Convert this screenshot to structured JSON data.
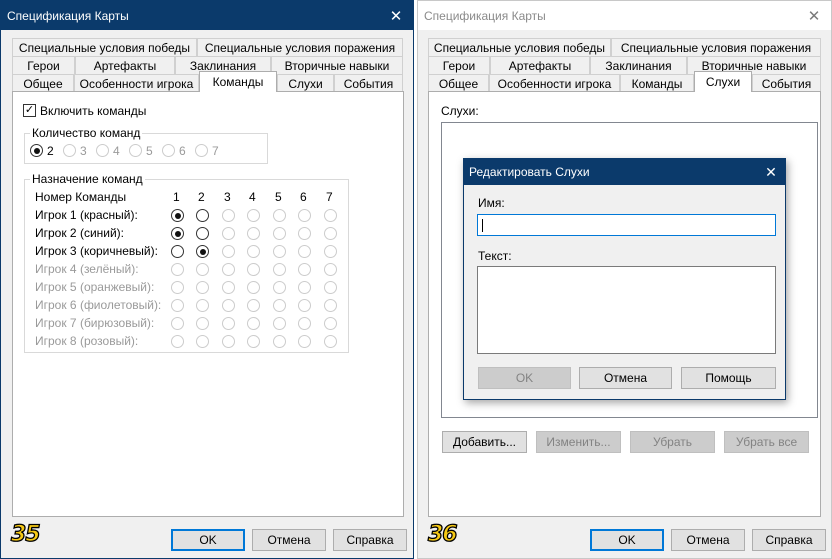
{
  "left_window": {
    "title": "Спецификация Карты",
    "badge": "35",
    "tabs_row1": [
      "Специальные условия победы",
      "Специальные условия поражения"
    ],
    "tabs_row2": [
      "Герои",
      "Артефакты",
      "Заклинания",
      "Вторичные навыки"
    ],
    "tabs_row3": [
      "Общее",
      "Особенности игрока",
      "Команды",
      "Слухи",
      "События"
    ],
    "enable_teams_label": "Включить команды",
    "enable_teams_checked": true,
    "team_count": {
      "title": "Количество команд",
      "options": [
        "2",
        "3",
        "4",
        "5",
        "6",
        "7"
      ],
      "selected": "2"
    },
    "assignment": {
      "title": "Назначение команд",
      "header_label": "Номер Команды",
      "team_numbers": [
        "1",
        "2",
        "3",
        "4",
        "5",
        "6",
        "7"
      ],
      "players": [
        {
          "label": "Игрок 1 (красный):",
          "team": 1,
          "enabled": true
        },
        {
          "label": "Игрок 2 (синий):",
          "team": 1,
          "enabled": true
        },
        {
          "label": "Игрок 3 (коричневый):",
          "team": 2,
          "enabled": true
        },
        {
          "label": "Игрок 4 (зелёный):",
          "team": 0,
          "enabled": false
        },
        {
          "label": "Игрок 5 (оранжевый):",
          "team": 0,
          "enabled": false
        },
        {
          "label": "Игрок 6 (фиолетовый):",
          "team": 0,
          "enabled": false
        },
        {
          "label": "Игрок 7 (бирюзовый):",
          "team": 0,
          "enabled": false
        },
        {
          "label": "Игрок 8 (розовый):",
          "team": 0,
          "enabled": false
        }
      ]
    },
    "buttons": {
      "ok": "OK",
      "cancel": "Отмена",
      "help": "Справка"
    }
  },
  "right_window": {
    "title": "Спецификация Карты",
    "badge": "36",
    "tabs_row1": [
      "Специальные условия победы",
      "Специальные условия поражения"
    ],
    "tabs_row2": [
      "Герои",
      "Артефакты",
      "Заклинания",
      "Вторичные навыки"
    ],
    "tabs_row3": [
      "Общее",
      "Особенности игрока",
      "Команды",
      "Слухи",
      "События"
    ],
    "rumors_label": "Слухи:",
    "list_buttons": {
      "add": "Добавить...",
      "edit": "Изменить...",
      "remove": "Убрать",
      "remove_all": "Убрать все"
    },
    "buttons": {
      "ok": "OK",
      "cancel": "Отмена",
      "help": "Справка"
    }
  },
  "dialog": {
    "title": "Редактировать Слухи",
    "name_label": "Имя:",
    "name_value": "",
    "text_label": "Текст:",
    "text_value": "",
    "buttons": {
      "ok": "OK",
      "cancel": "Отмена",
      "help": "Помощь"
    }
  },
  "colors": {
    "title_active": "#0b3a6b",
    "focus": "#0078d7",
    "badge_yellow": "#f6c915"
  }
}
